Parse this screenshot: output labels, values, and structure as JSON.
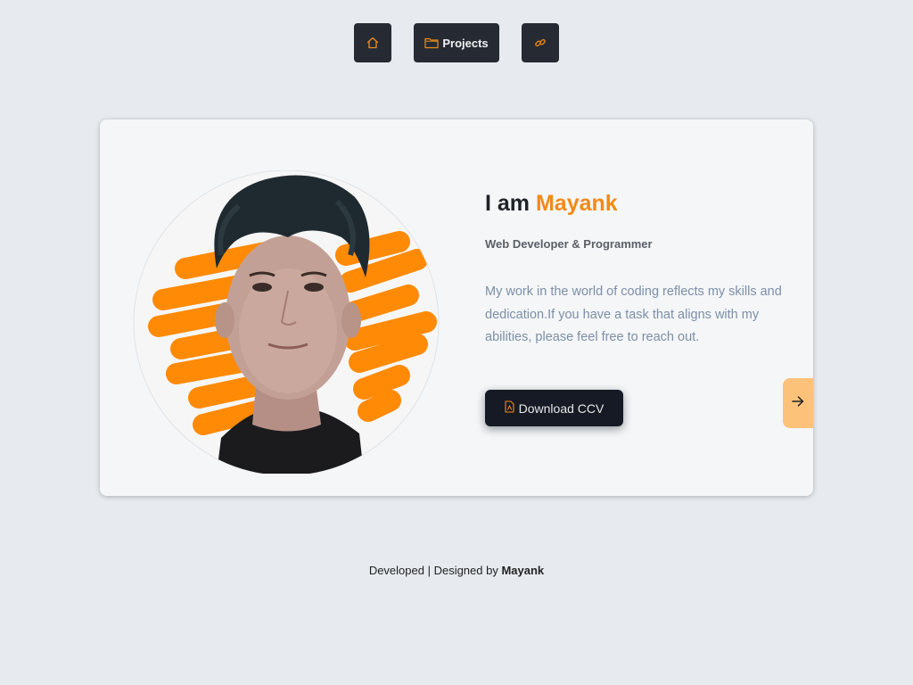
{
  "nav": {
    "home_icon": "home-icon",
    "projects_icon": "folder-icon",
    "projects_label": "Projects",
    "link_icon": "link-icon"
  },
  "hero": {
    "intro": "I am",
    "name": "Mayank",
    "role": "Web Developer & Programmer",
    "description": "My work in the world of coding reflects my skills and dedication.If you have a task that aligns with my abilities, please feel free to reach out.",
    "download_label": "Download CCV",
    "download_icon": "pdf-file-icon",
    "next_icon": "arrow-right-icon"
  },
  "footer": {
    "prefix": "Developed | Designed by",
    "author": "Mayank"
  },
  "colors": {
    "accent": "#f28a16",
    "dark": "#151a24",
    "page_bg": "#e7ebef",
    "card_bg": "#f4f6f8"
  }
}
